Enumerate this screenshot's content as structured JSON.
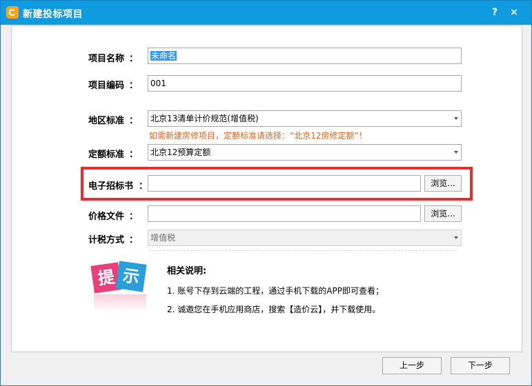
{
  "window": {
    "title": "新建投标项目",
    "help_label": "?",
    "close_label": "×"
  },
  "form": {
    "project_name": {
      "label": "项目名称",
      "colon": "：",
      "value": "未命名"
    },
    "project_code": {
      "label": "项目编码",
      "colon": "：",
      "value": "001"
    },
    "region_standard": {
      "label": "地区标准",
      "colon": "：",
      "value": "北京13清单计价规范(增值税)"
    },
    "warning": "如需新建房修项目，定额标准请选择：“北京12房修定额”！",
    "quota_standard": {
      "label": "定额标准",
      "colon": "：",
      "value": "北京12预算定额"
    },
    "tender_doc": {
      "label": "电子招标书",
      "colon": "：",
      "value": "",
      "browse_label": "浏览..."
    },
    "price_file": {
      "label": "价格文件",
      "colon": "：",
      "value": "",
      "browse_label": "浏览..."
    },
    "tax_method": {
      "label": "计税方式",
      "colon": "：",
      "value": "增值税"
    }
  },
  "info": {
    "badge_text_1": "提",
    "badge_text_2": "示",
    "title": "相关说明:",
    "notes": [
      "1. 账号下存到云端的工程，通过手机下载的APP即可查看；",
      "2. 诚邀您在手机应用商店，搜索【造价云】，并下载使用。"
    ]
  },
  "footer": {
    "prev_label": "上一步",
    "next_label": "下一步"
  },
  "colors": {
    "titlebar": "#0e9be0",
    "warning": "#e0631b",
    "highlight": "#ee2a2a"
  }
}
